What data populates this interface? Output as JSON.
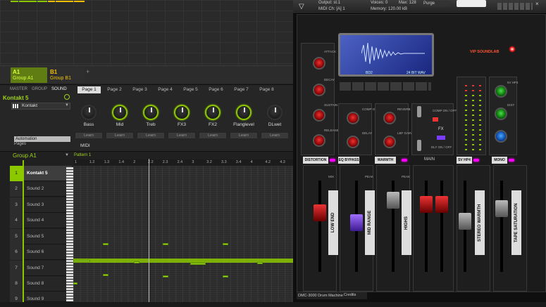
{
  "groups": {
    "a": {
      "letter": "A1",
      "name": "Group A1"
    },
    "b": {
      "letter": "B1",
      "name": "Group B1"
    },
    "add": "+"
  },
  "controls": {
    "tabs": [
      "MASTER",
      "GROUP",
      "SOUND"
    ],
    "pages": [
      "Page 1",
      "Page 2",
      "Page 3",
      "Page 4",
      "Page 5",
      "Page 6",
      "Page 7",
      "Page 8"
    ],
    "instrument": "Kontakt 5",
    "plugin": "Kontakt",
    "knobs": [
      "Bass",
      "Mid",
      "Treb",
      "FX3",
      "FX2",
      "Flanglevel",
      "DLwet"
    ],
    "learn": "Learn",
    "automation": "Automation",
    "pages_label": "Pages",
    "midi": "MIDI"
  },
  "sequencer": {
    "group": "Group A1",
    "pattern": "Pattern 1",
    "ruler": [
      "1",
      "1.2",
      "1.3",
      "1.4",
      "2",
      "2.2",
      "2.3",
      "2.4",
      "3",
      "3.2",
      "3.3",
      "3.4",
      "4",
      "4.2",
      "4.3"
    ],
    "sounds": [
      {
        "num": "1",
        "name": "Kontakt 5"
      },
      {
        "num": "2",
        "name": "Sound 2"
      },
      {
        "num": "3",
        "name": "Sound 3"
      },
      {
        "num": "4",
        "name": "Sound 4"
      },
      {
        "num": "5",
        "name": "Sound 5"
      },
      {
        "num": "6",
        "name": "Sound 6"
      },
      {
        "num": "7",
        "name": "Sound 7"
      },
      {
        "num": "8",
        "name": "Sound 8"
      },
      {
        "num": "9",
        "name": "Sound 9"
      }
    ]
  },
  "kontakt": {
    "output": "Output: st.1",
    "midich": "MIDI Ch: [A] 1",
    "voices": "Voices: 0",
    "max": "Max: 128",
    "memory": "Memory: 120.00 kB",
    "purge": "Purge",
    "screen_left": "BD2",
    "screen_right": "24 BIT WAV",
    "brand": "VIP SOUNDLAB",
    "knob_labels": [
      "ATTACK",
      "DECAY",
      "SUSTAIN",
      "RELEASE",
      "COMP OUT",
      "DELAY",
      "REVERB",
      "LBF GAIN",
      "COMP ON / OFF",
      "FX",
      "DLY ON / OFF",
      "5V HP4",
      "DIST"
    ],
    "tags": [
      "DISTORTION",
      "EQ BYPASS",
      "WARMTH",
      "MAIN",
      "SV HP4",
      "MONO"
    ],
    "strips": [
      "LOW END",
      "MID RANGE",
      "HIGHS",
      "STEREO WARMTH",
      "TAPE SATURATION"
    ],
    "mix": "MIX",
    "peak": "PEAK",
    "footer": "DMC-3000 Drum Machine",
    "credits": "Credits"
  }
}
